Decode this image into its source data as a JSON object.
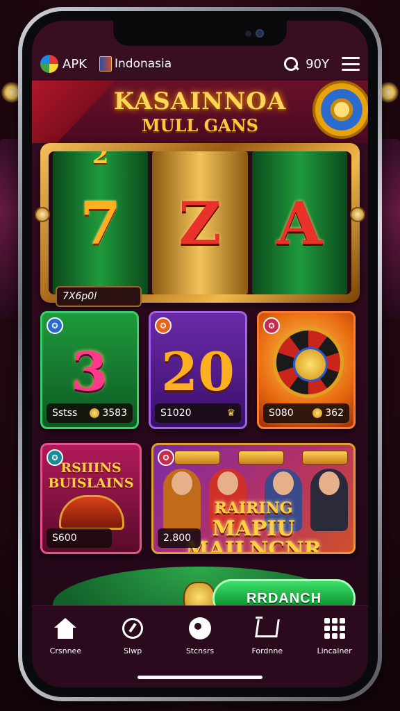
{
  "header": {
    "brand": "APK",
    "region": "Indonasia",
    "balance": "90Y"
  },
  "banner": {
    "title": "KASAINNOA",
    "subtitle": "MULL GANS"
  },
  "slot": {
    "reels": [
      {
        "top": "2",
        "symbol": "7"
      },
      {
        "top": "",
        "symbol": "Z"
      },
      {
        "top": "",
        "symbol": "A"
      }
    ],
    "label": "7X6p0l"
  },
  "tiles": [
    {
      "big": "3",
      "name": "Sstss",
      "value": "3583",
      "accent": "#1f9a3c"
    },
    {
      "big": "20",
      "name": "S1020",
      "value": "",
      "accent": "#6a2aa8"
    },
    {
      "big": "",
      "name": "S080",
      "value": "362",
      "accent": "#e86a10"
    },
    {
      "title": "RSIIINS BUISLAINS",
      "name": "S600",
      "accent": "#b01a5a"
    },
    {
      "title": "MAPIU MAILNCNR",
      "overlay": "RAIRING",
      "name": "2.800",
      "accent": "#b0306a"
    }
  ],
  "cta": {
    "label": "RRDANCH"
  },
  "tabbar": [
    {
      "label": "Crsnnee",
      "icon": "home-icon"
    },
    {
      "label": "Slwp",
      "icon": "spin-icon"
    },
    {
      "label": "Stcnsrs",
      "icon": "lens-icon"
    },
    {
      "label": "Fordnne",
      "icon": "cart-icon"
    },
    {
      "label": "Lincalner",
      "icon": "grid-icon"
    }
  ]
}
